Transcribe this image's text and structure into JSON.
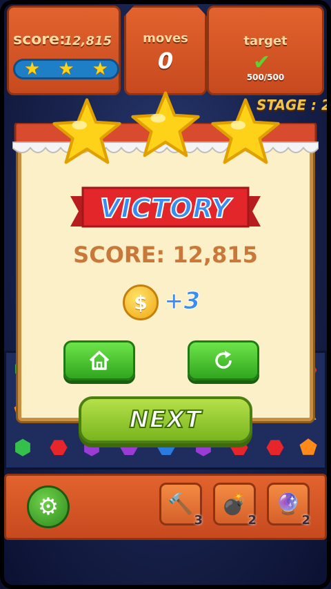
{
  "hud": {
    "score_label": "score:",
    "score_value": "12,815",
    "stars_earned": 3,
    "moves_label": "moves",
    "moves_value": "0",
    "target_label": "target",
    "target_value": "500/500",
    "stage_label": "STAGE : 2"
  },
  "popup": {
    "title": "VICTORY",
    "stars": 3,
    "score_text": "SCORE: 12,815",
    "coin_symbol": "$",
    "coin_bonus": "+3",
    "home_icon": "home-icon",
    "retry_icon": "retry-icon",
    "next_label": "NEXT"
  },
  "boosters": [
    {
      "icon": "hammer-icon",
      "count": "3"
    },
    {
      "icon": "bomb-icon",
      "count": "2"
    },
    {
      "icon": "rainbow-ball-icon",
      "count": "2"
    }
  ],
  "colors": {
    "accent_orange": "#e2632d",
    "popup_bg": "#fbf0c7",
    "title_blue": "#3a8cf0",
    "ribbon_red": "#e3262a",
    "button_green": "#2fa61e",
    "star_yellow": "#ffd21a"
  }
}
